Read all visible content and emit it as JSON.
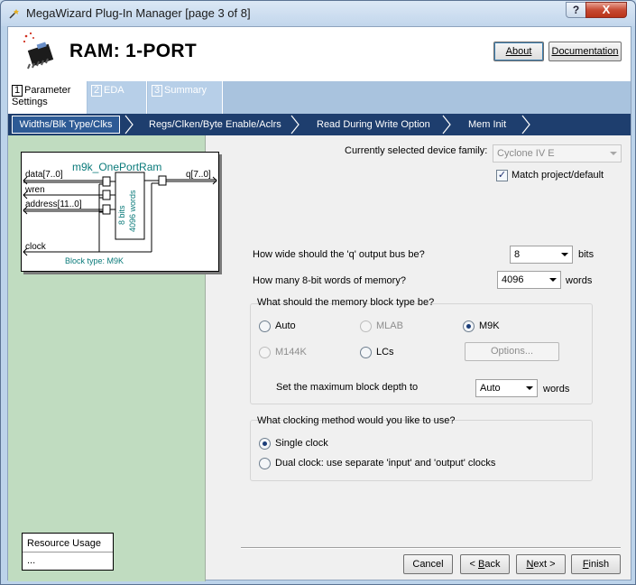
{
  "window": {
    "title": "MegaWizard Plug-In Manager [page 3 of 8]",
    "help_label": "?",
    "close_label": "X"
  },
  "header": {
    "title": "RAM: 1-PORT",
    "about_label": "About",
    "documentation_label": "Documentation"
  },
  "tabs": [
    {
      "num": "1",
      "label": "Parameter Settings"
    },
    {
      "num": "2",
      "label": "EDA"
    },
    {
      "num": "3",
      "label": "Summary"
    }
  ],
  "subnav": [
    {
      "label": "Widths/Blk Type/Clks"
    },
    {
      "label": "Regs/Clken/Byte Enable/Aclrs"
    },
    {
      "label": "Read During Write Option"
    },
    {
      "label": "Mem Init"
    }
  ],
  "symbol": {
    "name": "m9k_OnePortRam",
    "port_data": "data[7..0]",
    "port_wren": "wren",
    "port_address": "address[11..0]",
    "port_clock": "clock",
    "port_q": "q[7..0]",
    "mem_bits": "8 bits",
    "mem_words": "4096 words",
    "block_type": "Block type: M9K"
  },
  "resource": {
    "title": "Resource Usage",
    "value": "..."
  },
  "device": {
    "label": "Currently selected device family:",
    "value": "Cyclone IV E",
    "match_label": "Match project/default",
    "match_checked": true
  },
  "q_width": {
    "question": "How wide should the 'q' output bus be?",
    "value": "8",
    "unit": "bits"
  },
  "words": {
    "question": "How many 8-bit words of memory?",
    "value": "4096",
    "unit": "words"
  },
  "block_type": {
    "title": "What should the memory block type be?",
    "options": [
      {
        "label": "Auto",
        "checked": false,
        "enabled": true
      },
      {
        "label": "MLAB",
        "checked": false,
        "enabled": false
      },
      {
        "label": "M9K",
        "checked": true,
        "enabled": true
      },
      {
        "label": "M144K",
        "checked": false,
        "enabled": false
      },
      {
        "label": "LCs",
        "checked": false,
        "enabled": true
      }
    ],
    "options_button": "Options...",
    "depth_label": "Set the maximum block depth to",
    "depth_value": "Auto",
    "depth_unit": "words"
  },
  "clocking": {
    "title": "What clocking method would you like to use?",
    "options": [
      {
        "label": "Single clock",
        "checked": true
      },
      {
        "label": "Dual clock: use separate 'input' and 'output' clocks",
        "checked": false
      }
    ]
  },
  "footer": {
    "cancel": "Cancel",
    "back_prefix": "< ",
    "back_u": "B",
    "back_rest": "ack",
    "next_u": "N",
    "next_rest": "ext >",
    "finish_u": "F",
    "finish_rest": "inish"
  }
}
